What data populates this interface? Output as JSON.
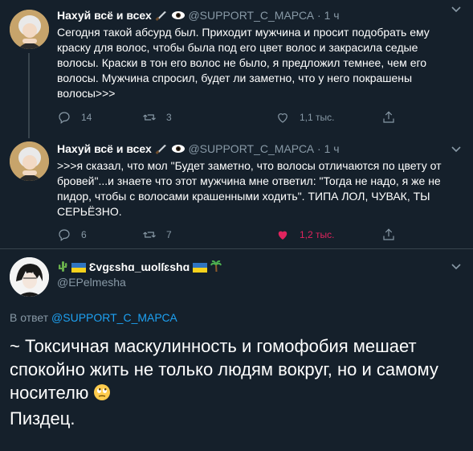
{
  "tweet1": {
    "name": "Нахуй всё и всех",
    "handle": "@SUPPORT_C_МАРСА",
    "dot": "·",
    "time": "1 ч",
    "text": "Сегодня такой абсурд был. Приходит мужчина и просит подобрать ему краску для волос, чтобы была под его цвет волос и закрасила седые волосы. Краски в тон его волос не было, я предложил темнее, чем его волосы. Мужчина спросил, будет ли заметно, что у него покрашены волосы>>>",
    "replies": "14",
    "retweets": "3",
    "likes": "1,1 тыс."
  },
  "tweet2": {
    "name": "Нахуй всё и всех",
    "handle": "@SUPPORT_C_МАРСА",
    "dot": "·",
    "time": "1 ч",
    "text": ">>>я сказал, что мол \"Будет заметно, что волосы отличаются по цвету от бровей\"...и знаете что этот мужчина мне ответил: \"Тогда не надо, я же не пидор, чтобы с волосами крашенными ходить\". ТИПА ЛОЛ, ЧУВАК, ТЫ СЕРЬЁЗНО.",
    "replies": "6",
    "retweets": "7",
    "likes": "1,2 тыс."
  },
  "reply": {
    "name": "Ɛvgɛshɑ_ɯolſɛshɑ",
    "handle": "@EPelmesha",
    "in_reply_prefix": "В ответ",
    "in_reply_to": "@SUPPORT_C_МАРСА",
    "text": "~ Токсичная маскулинность и гомофобия мешает спокойно жить не только людям вокруг, но и самому носителю",
    "text2": "Пиздец."
  },
  "colors": {
    "background": "#15202b",
    "secondary_text": "#8899a6",
    "link": "#1da1f2",
    "like": "#e0245e",
    "divider": "#38444d"
  },
  "icons": [
    "knife-icon",
    "eye-icon",
    "chevron-down-icon",
    "reply-icon",
    "retweet-icon",
    "heart-icon",
    "share-icon",
    "cactus-icon",
    "ukraine-flag-icon",
    "palm-tree-icon",
    "rolling-eyes-emoji"
  ]
}
